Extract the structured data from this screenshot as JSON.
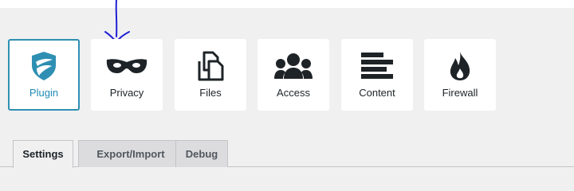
{
  "nav": {
    "items": [
      {
        "label": "Plugin",
        "icon": "shield-logo-icon",
        "active": true
      },
      {
        "label": "Privacy",
        "icon": "mask-icon",
        "active": false
      },
      {
        "label": "Files",
        "icon": "files-icon",
        "active": false
      },
      {
        "label": "Access",
        "icon": "users-icon",
        "active": false
      },
      {
        "label": "Content",
        "icon": "content-lines-icon",
        "active": false
      },
      {
        "label": "Firewall",
        "icon": "fire-icon",
        "active": false
      }
    ]
  },
  "tabs": {
    "items": [
      {
        "label": "Settings",
        "active": true
      },
      {
        "label": "Export/Import",
        "active": false
      },
      {
        "label": "Debug",
        "active": false
      }
    ]
  },
  "colors": {
    "page_background": "#f0f0f1",
    "tile_background": "#ffffff",
    "accent": "#2e8fb3",
    "icon": "#1d2327",
    "annotation": "#1f1fd6"
  }
}
